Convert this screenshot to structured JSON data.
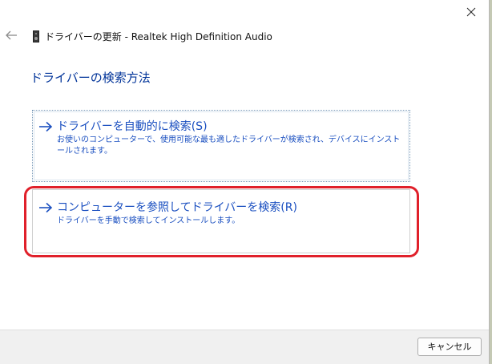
{
  "window": {
    "close_glyph": "✕"
  },
  "header": {
    "title": "ドライバーの更新 - Realtek High Definition Audio",
    "back_icon": "back-arrow-icon",
    "device_icon": "speaker-device-icon"
  },
  "page": {
    "heading": "ドライバーの検索方法"
  },
  "options": [
    {
      "title": "ドライバーを自動的に検索(S)",
      "description": "お使いのコンピューターで、使用可能な最も適したドライバーが検索され、デバイスにインストールされます。"
    },
    {
      "title": "コンピューターを参照してドライバーを検索(R)",
      "description": "ドライバーを手動で検索してインストールします。"
    }
  ],
  "footer": {
    "cancel_label": "キャンセル"
  },
  "colors": {
    "link_blue": "#1a4fc0",
    "heading_blue": "#003399",
    "highlight_red": "#e0202a"
  }
}
